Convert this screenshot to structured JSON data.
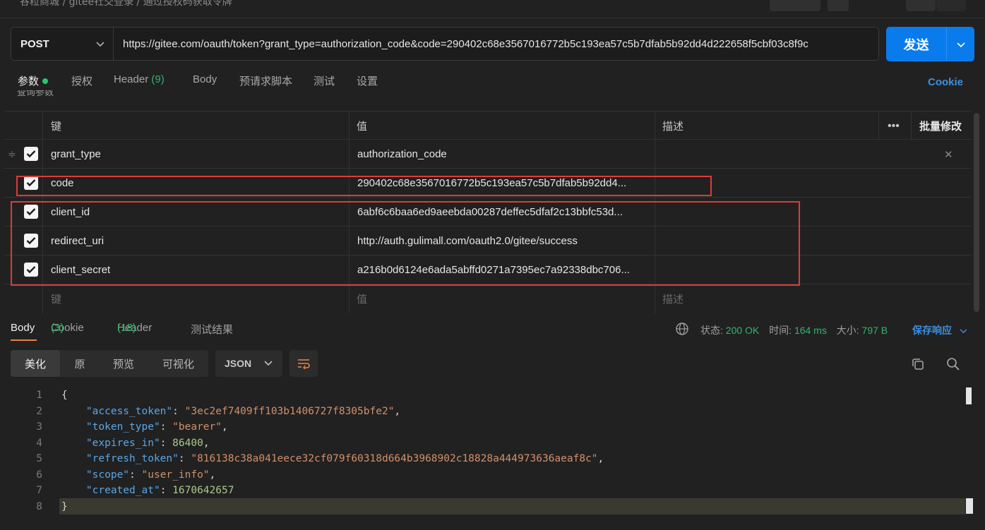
{
  "breadcrumb": "谷粒商城  /  gitee社交登录  /  通过授权码获取令牌",
  "request": {
    "method": "POST",
    "url": "https://gitee.com/oauth/token?grant_type=authorization_code&code=290402c68e3567016772b5c193ea57c5b7dfab5b92dd4d222658f5cbf03c8f9c",
    "send_label": "发送"
  },
  "req_tabs": {
    "params": "参数",
    "auth": "授权",
    "header": "Header",
    "header_count": "(9)",
    "body": "Body",
    "prescript": "预请求脚本",
    "test": "测试",
    "settings": "设置",
    "cookie": "Cookie"
  },
  "query_params_label": "查询参数",
  "table": {
    "headers": {
      "key": "键",
      "value": "值",
      "desc": "描述",
      "bulk_edit": "批量修改"
    },
    "rows": [
      {
        "key": "grant_type",
        "value": "authorization_code"
      },
      {
        "key": "code",
        "value": "290402c68e3567016772b5c193ea57c5b7dfab5b92dd4..."
      },
      {
        "key": "client_id",
        "value": "6abf6c6baa6ed9aeebda00287deffec5dfaf2c13bbfc53d..."
      },
      {
        "key": "redirect_uri",
        "value": "http://auth.gulimall.com/oauth2.0/gitee/success"
      },
      {
        "key": "client_secret",
        "value": "a216b0d6124e6ada5abffd0271a7395ec7a92338dbc706..."
      }
    ],
    "placeholder": {
      "key": "键",
      "value": "值",
      "desc": "描述"
    }
  },
  "resp_tabs": {
    "body": "Body",
    "cookie": "Cookie",
    "cookie_count": "(3)",
    "header": "Header",
    "header_count": "(18)",
    "test_results": "测试结果"
  },
  "status": {
    "status_label": "状态:",
    "status_value": "200 OK",
    "time_label": "时间:",
    "time_value": "164 ms",
    "size_label": "大小:",
    "size_value": "797 B",
    "save_label": "保存响应"
  },
  "format": {
    "pretty": "美化",
    "raw": "原",
    "preview": "预览",
    "visualize": "可视化",
    "type": "JSON"
  },
  "response_lines": [
    {
      "n": "1",
      "text": "{"
    },
    {
      "n": "2",
      "key": "\"access_token\"",
      "val": "\"3ec2ef7409ff103b1406727f8305bfe2\"",
      "type": "s",
      "comma": ","
    },
    {
      "n": "3",
      "key": "\"token_type\"",
      "val": "\"bearer\"",
      "type": "s",
      "comma": ","
    },
    {
      "n": "4",
      "key": "\"expires_in\"",
      "val": "86400",
      "type": "n",
      "comma": ","
    },
    {
      "n": "5",
      "key": "\"refresh_token\"",
      "val": "\"816138c38a041eece32cf079f60318d664b3968902c18828a444973636aeaf8c\"",
      "type": "s",
      "comma": ","
    },
    {
      "n": "6",
      "key": "\"scope\"",
      "val": "\"user_info\"",
      "type": "s",
      "comma": ","
    },
    {
      "n": "7",
      "key": "\"created_at\"",
      "val": "1670642657",
      "type": "n",
      "comma": ""
    },
    {
      "n": "8",
      "text": "}"
    }
  ]
}
